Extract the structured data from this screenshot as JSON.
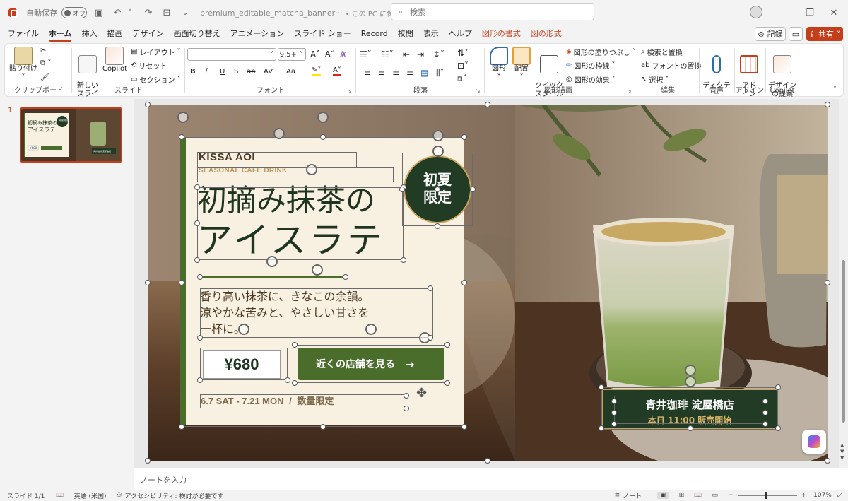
{
  "titlebar": {
    "autosave_label": "自動保存",
    "toggle_state": "オフ",
    "filename": "premium_editable_matcha_banner···",
    "save_location": "• この PC に保存済み ˅",
    "search_placeholder": "検索"
  },
  "tabs": [
    "ファイル",
    "ホーム",
    "挿入",
    "描画",
    "デザイン",
    "画面切り替え",
    "アニメーション",
    "スライド ショー",
    "Record",
    "校閲",
    "表示",
    "ヘルプ"
  ],
  "context_tabs": [
    "図形の書式",
    "図の形式"
  ],
  "header_buttons": {
    "record": "記録",
    "share": "共有"
  },
  "ribbon": {
    "clipboard": {
      "paste": "貼り付け",
      "group": "クリップボード"
    },
    "slides": {
      "new_slide": "新しい\nスライド",
      "copilot": "Copilot",
      "layout": "レイアウト",
      "reset": "リセット",
      "section": "セクション",
      "group": "スライド"
    },
    "font": {
      "font_name": "",
      "font_size": "9.5+",
      "group": "フォント",
      "bold": "B",
      "italic": "I",
      "underline": "U",
      "shadow": "S",
      "strike": "ab",
      "spacing": "AV",
      "case": "Aa"
    },
    "paragraph": {
      "group": "段落"
    },
    "drawing": {
      "shapes": "図形",
      "arrange": "配置",
      "quick_styles": "クイック\nスタイル",
      "fill": "図形の塗りつぶし",
      "outline": "図形の枠線",
      "effects": "図形の効果",
      "group": "図形描画"
    },
    "editing": {
      "find": "検索と置換",
      "replace_font": "フォントの置換",
      "select": "選択",
      "group": "編集"
    },
    "voice": {
      "dictate": "ディクテー\nション",
      "group": "音声"
    },
    "addins": {
      "label": "アド\nイン",
      "group": "アドイン"
    },
    "copilot": {
      "designer": "デザイン\nの提案",
      "group": "Copilot"
    }
  },
  "slide_panel": {
    "number": "1"
  },
  "slide": {
    "brand": "KISSA AOI",
    "subtitle": "SEASONAL CAFE DRINK",
    "title_line1": "初摘み抹茶の",
    "title_line2": "アイスラテ",
    "badge_line1": "初夏",
    "badge_line2": "限定",
    "body_line1": "香り高い抹茶に、きなこの余韻。",
    "body_line2": "涼やかな苦みと、やさしい甘さを",
    "body_line3": "一杯に。",
    "price": "¥680",
    "cta": "近くの店舗を見る",
    "cta_arrow": "→",
    "dates": "6.7 SAT - 7.21 MON",
    "slash": "/",
    "limited": "数量限定",
    "store_name": "青井珈琲 淀屋橋店",
    "store_time": "本日 11:00 販売開始"
  },
  "thumbnail": {
    "title1": "初摘み抹茶の",
    "title2": "アイスラテ",
    "price": "¥680",
    "badge": "初夏 限定",
    "store": "青井珈琲 淀屋橋店"
  },
  "notes_placeholder": "ノートを入力",
  "status": {
    "slide_count": "スライド 1/1",
    "language": "英語 (米国)",
    "accessibility": "アクセシビリティ: 検討が必要です",
    "notes": "ノート",
    "zoom": "107%"
  },
  "colors": {
    "accent": "#c43e1c",
    "matcha_dark": "#223b25",
    "matcha": "#4a6d2c",
    "cream": "#f8f1e2",
    "gold": "#c9a25a"
  }
}
